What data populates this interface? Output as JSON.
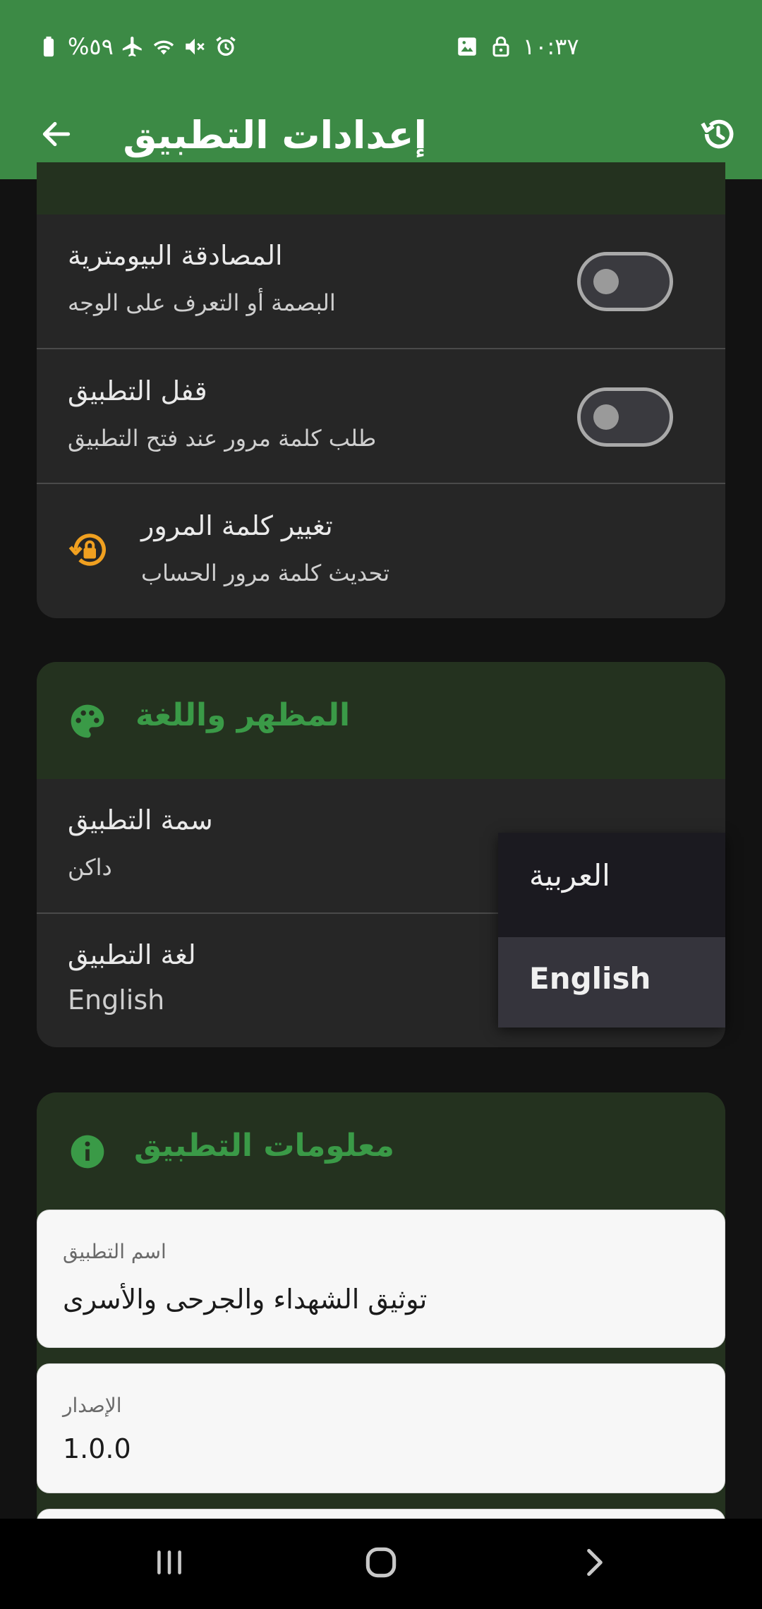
{
  "status_bar": {
    "battery_text": "%٥٩",
    "time": "١٠:٣٧",
    "icons": [
      "battery-icon",
      "airplane-icon",
      "wifi-icon",
      "mute-icon",
      "alarm-icon",
      "image-icon",
      "lock-icon"
    ]
  },
  "app_bar": {
    "title": "إعدادات التطبيق",
    "back_icon": "arrow-back-icon",
    "history_icon": "history-icon",
    "color": "#3c8a45"
  },
  "security": {
    "rows": [
      {
        "title": "المصادقة البيومترية",
        "subtitle": "البصمة أو التعرف على الوجه",
        "toggle_on": false
      },
      {
        "title": "قفل التطبيق",
        "subtitle": "طلب كلمة مرور عند فتح التطبيق",
        "toggle_on": false
      },
      {
        "title": "تغيير كلمة المرور",
        "subtitle": "تحديث كلمة مرور الحساب",
        "icon": "lock-reset-icon"
      }
    ]
  },
  "appearance": {
    "header": "المظهر واللغة",
    "header_icon": "palette-icon",
    "rows": [
      {
        "title": "سمة التطبيق",
        "subtitle": "داكن"
      },
      {
        "title": "لغة التطبيق",
        "subtitle": "English"
      }
    ],
    "language_menu": {
      "options": [
        "العربية",
        "English"
      ],
      "selected": "English"
    }
  },
  "info": {
    "header": "معلومات التطبيق",
    "header_icon": "info-icon",
    "fields": [
      {
        "label": "اسم التطبيق",
        "value": "توثيق الشهداء والجرحى والأسرى"
      },
      {
        "label": "الإصدار",
        "value": "1.0.0"
      }
    ]
  },
  "colors": {
    "accent_green": "#3a9a47",
    "warning_orange": "#f0a020",
    "card_bg": "#262626",
    "page_bg": "#121212"
  },
  "nav_bar": {
    "icons": [
      "recent-apps-icon",
      "home-icon",
      "back-chevron-icon"
    ]
  }
}
